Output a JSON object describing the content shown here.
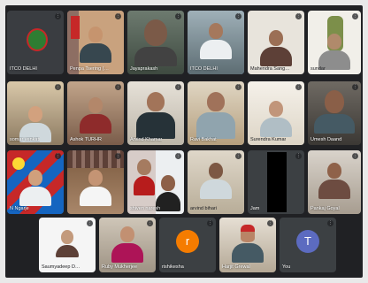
{
  "meeting": {
    "participants": [
      {
        "name": "ITCO DELHI",
        "kind": "logo"
      },
      {
        "name": "Penpa Tsering (Sikyong, C...",
        "kind": "video"
      },
      {
        "name": "Jayaprakash",
        "kind": "video"
      },
      {
        "name": "ITCO DELHI",
        "kind": "video"
      },
      {
        "name": "Mahendra Sanghav",
        "kind": "video"
      },
      {
        "name": "sundar",
        "kind": "video"
      },
      {
        "name": "somar venkati",
        "kind": "video"
      },
      {
        "name": "Ashok TURHR",
        "kind": "video"
      },
      {
        "name": "Arvind Khamar",
        "kind": "video"
      },
      {
        "name": "Ravi Bakhat",
        "kind": "video"
      },
      {
        "name": "Surendra Kumar",
        "kind": "video"
      },
      {
        "name": "Umesh Daand",
        "kind": "video"
      },
      {
        "name": "N Ngarje",
        "kind": "video"
      },
      {
        "name": "",
        "kind": "video"
      },
      {
        "name": "shiven naresh",
        "kind": "video"
      },
      {
        "name": "arvind bihari",
        "kind": "video"
      },
      {
        "name": "Jam",
        "kind": "video"
      },
      {
        "name": "Pankaj Goyal",
        "kind": "video"
      },
      {
        "name": "Saumyadeep Datta",
        "kind": "video"
      },
      {
        "name": "Ruby Mukherjee",
        "kind": "video"
      },
      {
        "name": "rishikesha",
        "kind": "avatar",
        "initial": "r",
        "color": "#f57c00"
      },
      {
        "name": "Harjit Grewal",
        "kind": "video"
      },
      {
        "name": "You",
        "kind": "avatar",
        "initial": "T",
        "color": "#5c6bc0"
      }
    ]
  }
}
